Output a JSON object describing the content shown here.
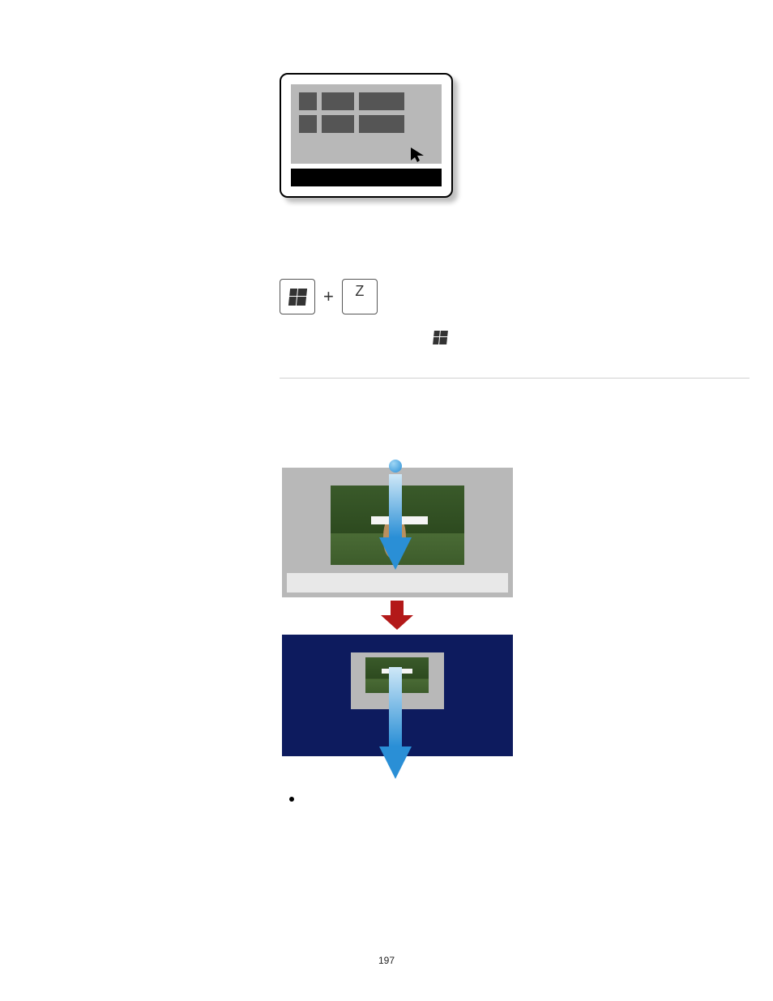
{
  "page_number": "197",
  "key_combo": {
    "key1_label": "windows",
    "plus": "+",
    "key2_label": "Z"
  },
  "inline_icon": "windows-logo",
  "diagram": {
    "description": "drag-down-to-close-app"
  }
}
